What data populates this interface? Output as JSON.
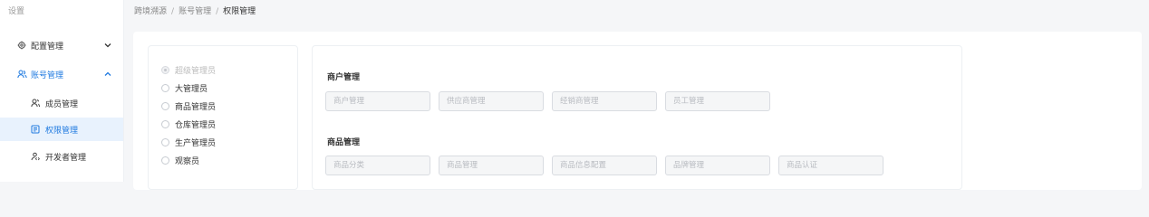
{
  "sidebar": {
    "header": "设置",
    "items": [
      {
        "label": "配置管理",
        "icon": "gear-icon",
        "expanded": false
      },
      {
        "label": "账号管理",
        "icon": "users-icon",
        "expanded": true
      },
      {
        "label": "成员管理",
        "icon": "user-icon"
      },
      {
        "label": "权限管理",
        "icon": "shield-list-icon",
        "active": true
      },
      {
        "label": "开发者管理",
        "icon": "developer-icon"
      }
    ]
  },
  "breadcrumb": {
    "items": [
      "跨境溯源",
      "账号管理",
      "权限管理"
    ],
    "separator": "/"
  },
  "roles": [
    {
      "label": "超级管理员",
      "disabled": true,
      "checked": true
    },
    {
      "label": "大管理员"
    },
    {
      "label": "商品管理员"
    },
    {
      "label": "仓库管理员"
    },
    {
      "label": "生产管理员"
    },
    {
      "label": "观察员"
    }
  ],
  "permissions": {
    "sections": [
      {
        "title": "商户管理",
        "options": [
          "商户管理",
          "供应商管理",
          "经销商管理",
          "员工管理"
        ]
      },
      {
        "title": "商品管理",
        "options": [
          "商品分类",
          "商品管理",
          "商品信息配置",
          "品牌管理",
          "商品认证"
        ]
      }
    ]
  },
  "colors": {
    "accent": "#1f7ae0",
    "active_bg": "#e8f2fd"
  }
}
